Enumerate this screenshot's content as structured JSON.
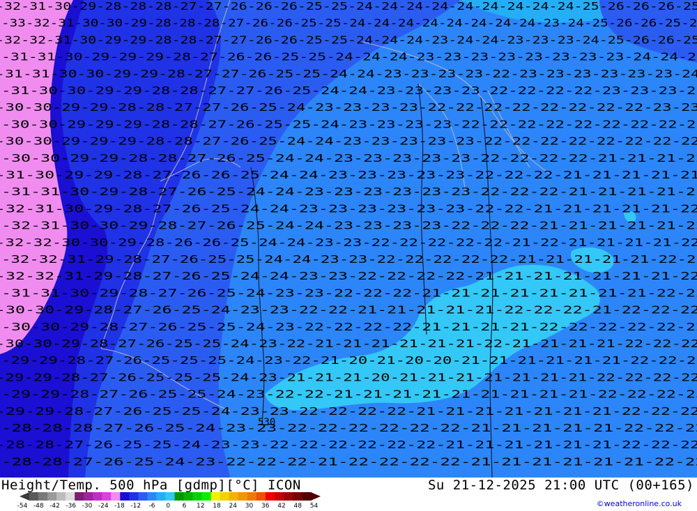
{
  "title": {
    "left": "Height/Temp. 500 hPa [gdmp][°C] ICON",
    "right": "Su 21-12-2025 21:00 UTC (00+165)"
  },
  "credit": "©weatheronline.co.uk",
  "colors": {
    "pink": "#f08cf0",
    "deep_blue": "#1a0fd2",
    "blue": "#1f32e6",
    "medium_blue": "#2b5cf2",
    "sky_blue": "#2c86fa",
    "light_blue": "#25aef8",
    "cyan": "#33c8f7",
    "contour_black": "#000000",
    "border_grey": "#b4b4c8"
  },
  "scale": {
    "colors": [
      "#5a5a5a",
      "#7a7a7a",
      "#9a9a9a",
      "#bcbcbc",
      "#dddddd",
      "#7a1e7a",
      "#a022a0",
      "#c02ec0",
      "#e040e0",
      "#f08cf0",
      "#1a0fd2",
      "#1f32e6",
      "#2b5cf2",
      "#2c86fa",
      "#25aef8",
      "#33c8f7",
      "#009600",
      "#00b400",
      "#00d200",
      "#00f000",
      "#f0f000",
      "#f0d200",
      "#f0b400",
      "#f09600",
      "#f07800",
      "#f05000",
      "#f00000",
      "#c80000",
      "#a00000",
      "#780000",
      "#500000"
    ],
    "labels": [
      "-54",
      "-48",
      "-42",
      "-36",
      "-30",
      "-24",
      "-18",
      "-12",
      "-6",
      "0",
      "6",
      "12",
      "18",
      "24",
      "30",
      "36",
      "42",
      "48",
      "54"
    ]
  },
  "contour_labels": {
    "city": "530",
    "rows": [
      "-32-31-30-29-28-28-28-27-27-26-26-26-25-25-24-24-24-24-24-24-24-24-24-25-26-26-26-25",
      "-33-32-31-30-30-29-28-28-28-27-26-26-25-25-24-24-24-24-24-24-24-24-23-24-25-26-26-25-26",
      "-32-32-31-30-29-29-28-28-27-27-26-26-25-25-24-24-24-23-24-24-23-23-23-24-25-26-26-25",
      "-31-31-30-29-29-29-28-27-26-26-25-25-24-24-24-23-23-23-23-23-23-23-23-24-24-25",
      "-31-31-30-30-29-29-28-27-27-26-25-25-24-24-23-23-23-23-22-23-23-23-23-23-23-24",
      "-31-30-30-29-29-28-28-27-27-26-25-24-24-23-23-23-23-22-22-22-22-23-23-23-23",
      "-30-30-29-29-28-28-27-27-26-25-24-23-23-23-23-22-22-22-22-22-22-22-22-23-23",
      "-30-30-29-29-29-28-28-27-26-25-25-24-23-23-23-23-22-22-22-22-22-22-22-22-22",
      "-30-30-29-29-29-28-28-27-26-25-24-24-23-23-23-23-23-22-22-22-22-22-22-22-22",
      "-30-30-29-29-28-28-27-26-25-24-24-23-23-23-23-23-22-22-22-22-21-21-21-22",
      "-31-30-29-29-28-27-26-26-25-24-24-23-23-23-23-23-22-22-22-21-21-21-21-21",
      "-31-31-30-29-28-27-26-25-24-24-23-23-23-23-23-23-22-22-22-21-21-21-21-21",
      "-32-31-30-29-28-27-26-25-24-24-23-23-23-23-23-23-22-22-21-21-21-21-21-22",
      "-32-31-30-30-29-28-27-26-25-24-24-23-23-23-23-22-22-22-21-21-21-21-21-22",
      "-32-32-30-30-29-28-26-26-25-24-24-23-23-22-22-22-22-22-21-22-21-21-21-21-22",
      "-32-32-31-29-28-27-26-25-25-24-24-23-23-22-22-22-22-22-21-21-21-21-21-22-22",
      "-32-32-31-29-28-27-26-25-24-24-23-23-22-22-22-22-21-21-21-21-21-21-21-22",
      "-31-31-30-29-28-27-26-25-24-23-23-22-22-22-21-21-21-21-21-21-21-21-22-22",
      "-30-30-29-28-27-26-25-24-23-23-22-22-21-21-21-21-21-22-22-22-21-22-22-22",
      "-30-30-29-28-27-26-25-25-24-23-22-22-22-22-21-21-21-21-22-22-22-22-22-22",
      "-30-30-29-28-27-26-25-25-24-23-22-21-21-21-21-21-21-22-21-21-21-21-22-22-22",
      "-29-29-28-27-26-25-25-25-24-23-22-21-20-21-20-20-21-21-21-21-21-21-22-22-22",
      "-29-29-28-27-26-25-25-25-24-23-21-21-21-20-21-21-21-21-21-21-21-22-22-22-22",
      "-29-29-28-27-26-25-25-24-23-22-22-21-21-21-21-21-21-21-21-21-22-22-22-23",
      "-29-29-28-27-26-25-25-24-23-23-22-22-22-22-21-21-21-21-21-21-21-22-22-22",
      "-28-28-28-27-26-25-24-23-23-22-22-22-22-22-22-21-21-21-21-21-22-22-22",
      "-28-28-27-26-25-25-24-23-23-22-22-22-22-22-22-21-21-21-21-21-21-22-22-22",
      "-28-28-27-26-25-24-23-22-22-22-21-22-22-22-22-21-21-21-21-21-21-22-22"
    ]
  }
}
